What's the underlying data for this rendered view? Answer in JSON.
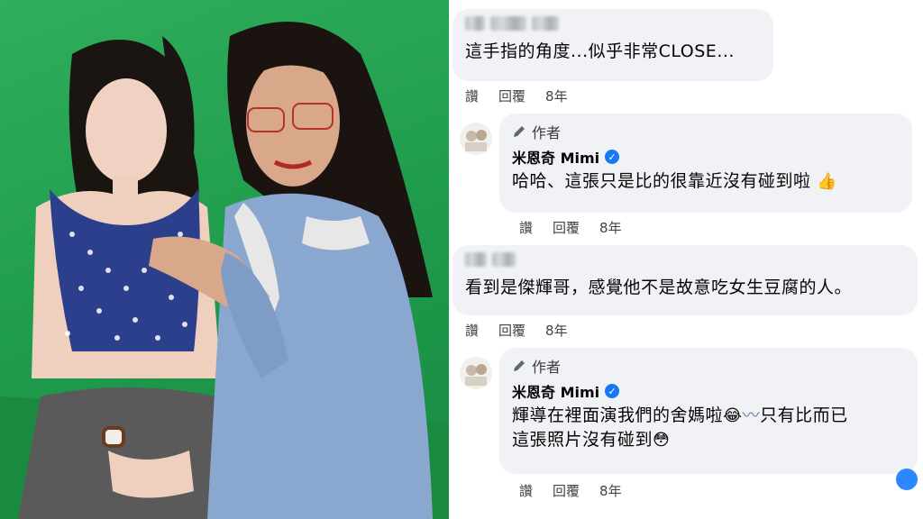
{
  "comments": [
    {
      "id": "c1",
      "author_blurred": true,
      "text": "這手指的角度...似乎非常CLOSE...",
      "actions": {
        "like": "讚",
        "reply": "回覆",
        "time": "8年"
      }
    },
    {
      "id": "r1",
      "author_tag": "作者",
      "author": "米恩奇 Mimi",
      "verified": true,
      "text": "哈哈、這張只是比的很靠近沒有碰到啦",
      "emoji": "thumbs-up-emoji",
      "actions": {
        "like": "讚",
        "reply": "回覆",
        "time": "8年"
      }
    },
    {
      "id": "c2",
      "author_blurred": true,
      "text": "看到是傑輝哥，感覺他不是故意吃女生豆腐的人。",
      "actions": {
        "like": "讚",
        "reply": "回覆",
        "time": "8年"
      }
    },
    {
      "id": "r2",
      "author_tag": "作者",
      "author": "米恩奇 Mimi",
      "verified": true,
      "text_line1": "輝導在裡面演我們的舍媽啦",
      "text_line1_tail": "只有比而已",
      "text_line2": "這張照片沒有碰到",
      "actions": {
        "like": "讚",
        "reply": "回覆",
        "time": "8年"
      }
    }
  ],
  "colors": {
    "bubble": "#f0f2f5",
    "verified": "#1877f2",
    "photo_bg": "#1f9a4c"
  }
}
